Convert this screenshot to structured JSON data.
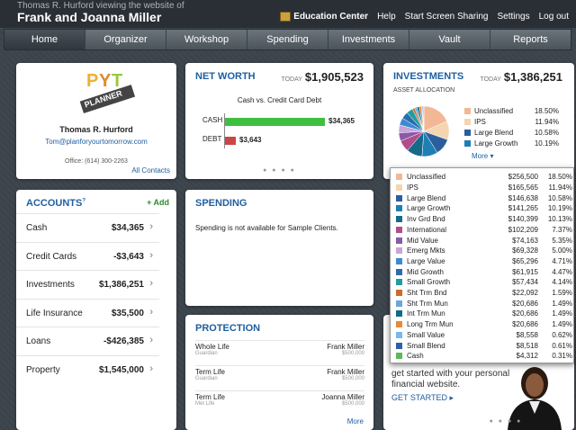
{
  "header": {
    "viewing": "Thomas R. Hurford viewing the website of",
    "client": "Frank and Joanna Miller",
    "links": [
      "Education Center",
      "Help",
      "Start Screen Sharing",
      "Settings",
      "Log out"
    ]
  },
  "nav": [
    "Home",
    "Organizer",
    "Workshop",
    "Spending",
    "Investments",
    "Vault",
    "Reports"
  ],
  "profile": {
    "logo_text": "PLANNER",
    "name": "Thomas R. Hurford",
    "email": "Tom@planforyourtomorrow.com",
    "office": "Office: (614) 300-2263",
    "contacts_link": "All Contacts"
  },
  "networth": {
    "title": "NET WORTH",
    "today_label": "TODAY",
    "today_value": "$1,905,523",
    "chart_title": "Cash vs. Credit Card Debt"
  },
  "chart_data": {
    "type": "bar",
    "title": "Cash vs. Credit Card Debt",
    "categories": [
      "CASH",
      "DEBT"
    ],
    "values": [
      34365,
      3643
    ],
    "value_labels": [
      "$34,365",
      "$3,643"
    ],
    "colors": [
      "#3fbf3f",
      "#cc4444"
    ]
  },
  "investments": {
    "title": "INVESTMENTS",
    "today_label": "TODAY",
    "today_value": "$1,386,251",
    "subtitle": "ASSET ALLOCATION",
    "legend": [
      {
        "name": "Unclassified",
        "pct": "18.50%",
        "color": "#f2b896"
      },
      {
        "name": "IPS",
        "pct": "11.94%",
        "color": "#f5d5b0"
      },
      {
        "name": "Large Blend",
        "pct": "10.58%",
        "color": "#2a5f9e"
      },
      {
        "name": "Large Growth",
        "pct": "10.19%",
        "color": "#1d7fb5"
      }
    ],
    "more": "More"
  },
  "allocation": [
    {
      "name": "Unclassified",
      "value": "$256,500",
      "pct": "18.50%",
      "share": 18.5,
      "color": "#f2b896"
    },
    {
      "name": "IPS",
      "value": "$165,565",
      "pct": "11.94%",
      "share": 11.94,
      "color": "#f5d5b0"
    },
    {
      "name": "Large Blend",
      "value": "$146,638",
      "pct": "10.58%",
      "share": 10.58,
      "color": "#2a5f9e"
    },
    {
      "name": "Large Growth",
      "value": "$141,265",
      "pct": "10.19%",
      "share": 10.19,
      "color": "#1d7fb5"
    },
    {
      "name": "Inv Grd Bnd",
      "value": "$140,399",
      "pct": "10.13%",
      "share": 10.13,
      "color": "#156a8a"
    },
    {
      "name": "International",
      "value": "$102,209",
      "pct": "7.37%",
      "share": 7.37,
      "color": "#b24c8a"
    },
    {
      "name": "Mid Value",
      "value": "$74,163",
      "pct": "5.35%",
      "share": 5.35,
      "color": "#8a5aa8"
    },
    {
      "name": "Emerg Mkts",
      "value": "$69,328",
      "pct": "5.00%",
      "share": 5.0,
      "color": "#c8a5d8"
    },
    {
      "name": "Large Value",
      "value": "$65,296",
      "pct": "4.71%",
      "share": 4.71,
      "color": "#3c8ad0"
    },
    {
      "name": "Mid Growth",
      "value": "$61,915",
      "pct": "4.47%",
      "share": 4.47,
      "color": "#2b6cb0"
    },
    {
      "name": "Small Growth",
      "value": "$57,434",
      "pct": "4.14%",
      "share": 4.14,
      "color": "#1f9ea0"
    },
    {
      "name": "Sht Trm Bnd",
      "value": "$22,092",
      "pct": "1.59%",
      "share": 1.59,
      "color": "#d06a2a"
    },
    {
      "name": "Sht Trm Mun",
      "value": "$20,686",
      "pct": "1.49%",
      "share": 1.49,
      "color": "#6aa8d8"
    },
    {
      "name": "Int Trm Mun",
      "value": "$20,686",
      "pct": "1.49%",
      "share": 1.49,
      "color": "#0e6b8a"
    },
    {
      "name": "Long Trm Mun",
      "value": "$20,686",
      "pct": "1.49%",
      "share": 1.49,
      "color": "#e88a3a"
    },
    {
      "name": "Small Value",
      "value": "$8,558",
      "pct": "0.62%",
      "share": 0.62,
      "color": "#7ab8e8"
    },
    {
      "name": "Small Blend",
      "value": "$8,518",
      "pct": "0.61%",
      "share": 0.61,
      "color": "#2f5fa8"
    },
    {
      "name": "Cash",
      "value": "$4,312",
      "pct": "0.31%",
      "share": 0.31,
      "color": "#5cb85c"
    }
  ],
  "accounts": {
    "title": "ACCOUNTS",
    "add": "+ Add",
    "rows": [
      {
        "label": "Cash",
        "value": "$34,365"
      },
      {
        "label": "Credit Cards",
        "value": "-$3,643"
      },
      {
        "label": "Investments",
        "value": "$1,386,251"
      },
      {
        "label": "Life Insurance",
        "value": "$35,500"
      },
      {
        "label": "Loans",
        "value": "-$426,385"
      },
      {
        "label": "Property",
        "value": "$1,545,000"
      }
    ]
  },
  "spending": {
    "title": "SPENDING",
    "message": "Spending is not available for Sample Clients."
  },
  "protection": {
    "title": "PROTECTION",
    "rows": [
      {
        "type": "Whole Life",
        "carrier": "Guardian",
        "owner": "Frank Miller",
        "amount": "$500,000"
      },
      {
        "type": "Term Life",
        "carrier": "Guardian",
        "owner": "Frank Miller",
        "amount": "$500,000"
      },
      {
        "type": "Term Life",
        "carrier": "Met Life",
        "owner": "Joanna Miller",
        "amount": "$500,000"
      }
    ],
    "more": "More"
  },
  "promo": {
    "line1": "get started with your personal",
    "line2": "financial website.",
    "cta": "GET STARTED"
  }
}
